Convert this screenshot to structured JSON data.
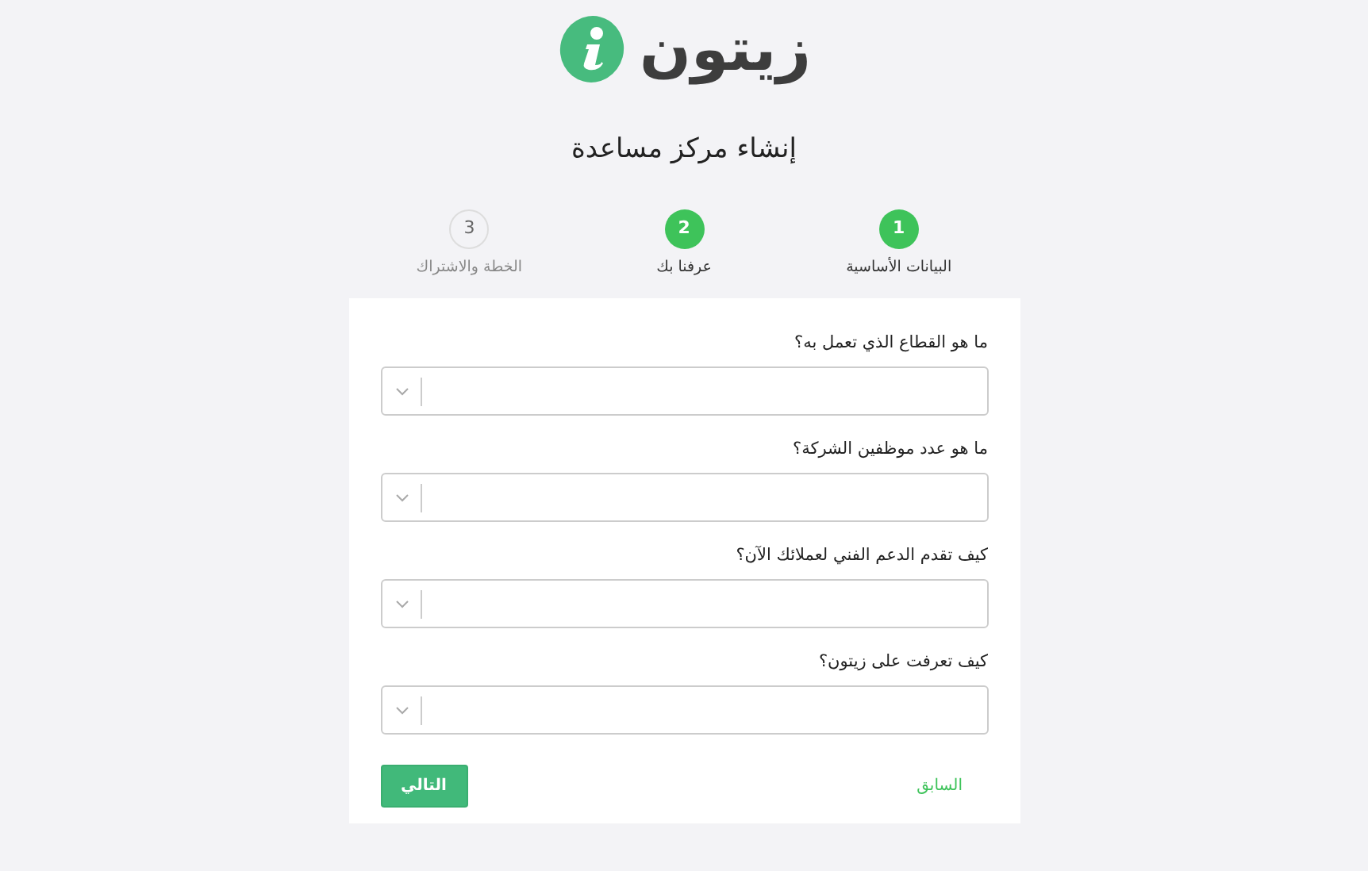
{
  "logo": {
    "text": "زيتون"
  },
  "title": "إنشاء مركز مساعدة",
  "steps": [
    {
      "number": "1",
      "label": "البيانات الأساسية",
      "reached": true
    },
    {
      "number": "2",
      "label": "عرفنا بك",
      "reached": true
    },
    {
      "number": "3",
      "label": "الخطة والاشتراك",
      "reached": false
    }
  ],
  "questions": [
    {
      "label": "ما هو القطاع الذي تعمل به؟"
    },
    {
      "label": "ما هو عدد موظفين الشركة؟"
    },
    {
      "label": "كيف تقدم الدعم الفني لعملائك الآن؟"
    },
    {
      "label": "كيف تعرفت على زيتون؟"
    }
  ],
  "buttons": {
    "next": "التالي",
    "back": "السابق"
  }
}
